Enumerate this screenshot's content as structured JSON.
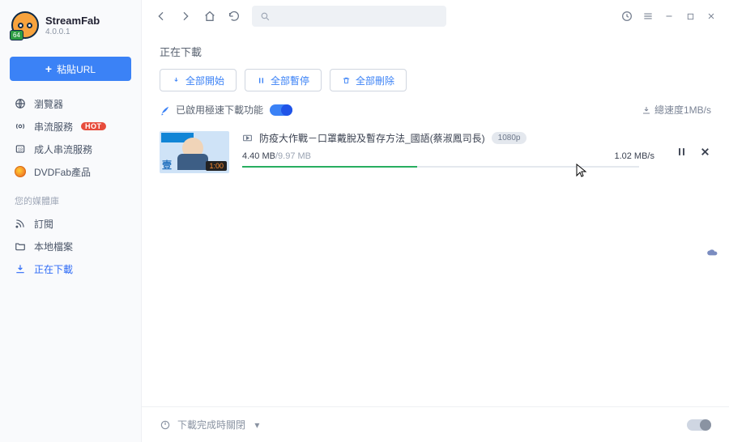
{
  "brand": {
    "name": "StreamFab",
    "version": "4.0.0.1",
    "arch_badge": "64"
  },
  "sidebar": {
    "paste_label": "粘貼URL",
    "items": [
      {
        "label": "瀏覽器"
      },
      {
        "label": "串流服務",
        "hot": "HOT"
      },
      {
        "label": "成人串流服務"
      },
      {
        "label": "DVDFab產品"
      }
    ],
    "lib_label": "您的媒體庫",
    "lib_items": [
      {
        "label": "訂閱"
      },
      {
        "label": "本地檔案"
      },
      {
        "label": "正在下載"
      }
    ]
  },
  "header": {
    "page_title": "正在下載",
    "actions": {
      "start_all": "全部開始",
      "pause_all": "全部暫停",
      "delete_all": "全部刪除"
    },
    "speed_mode_label": "已啟用極速下載功能",
    "total_speed_label": "總速度1MB/s"
  },
  "download": {
    "title": "防疫大作戰－口罩戴脫及暫存方法_國語(蔡淑鳳司長)",
    "quality": "1080p",
    "done": "4.40 MB",
    "total": "9.97 MB",
    "sep": " / ",
    "rate": "1.02 MB/s",
    "thumb_time": "1:00",
    "thumb_brand": "壹"
  },
  "footer": {
    "shutdown_label": "下載完成時關閉"
  }
}
